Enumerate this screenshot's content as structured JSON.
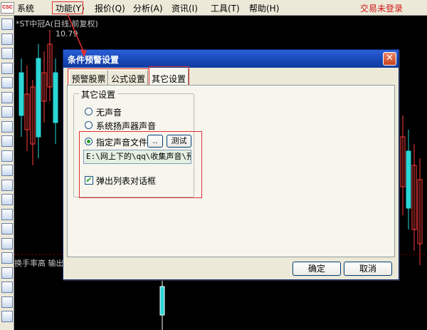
{
  "app": {
    "logo_text": "CSC",
    "login_status": "交易未登录"
  },
  "menu": {
    "items": [
      "系统",
      "功能(Y)",
      "报价(Q)",
      "分析(A)",
      "资讯(I)",
      "工具(T)",
      "帮助(H)"
    ]
  },
  "chart": {
    "title": "*ST中冠A(日线,前复权)",
    "price_label": "10.79",
    "indicator_label": "换手率高 输出",
    "colors": {
      "up": "#ff3b3b",
      "down": "#2ad6d6",
      "background": "#000000"
    }
  },
  "dialog": {
    "title": "条件预警设置",
    "close_label": "✕",
    "tabs": [
      "预警股票",
      "公式设置",
      "其它设置"
    ],
    "active_tab": "其它设置",
    "group_label": "其它设置",
    "options": {
      "no_sound": "无声音",
      "system_speaker": "系统扬声器声音",
      "custom_sound": "指定声音文件",
      "selected": "custom_sound"
    },
    "browse_label": "..",
    "test_label": "测试",
    "sound_path": "E:\\网上下的\\qq\\收集声音\\预",
    "popup_checkbox_label": "弹出列表对话框",
    "popup_checked": true,
    "ok_label": "确定",
    "cancel_label": "取消"
  },
  "toolbar_icons": [
    "window-icon",
    "monitor-icon",
    "line-chart-icon",
    "candle-icon",
    "bars-icon",
    "list-icon",
    "grid-icon",
    "table-icon",
    "mail-icon",
    "people-icon",
    "fund-icon",
    "search-icon",
    "etf-icon",
    "bars2-icon",
    "rsi-icon",
    "chart2-icon",
    "sheet-icon",
    "dollar-icon",
    "tools-icon",
    "exit-icon",
    "pencil-icon"
  ]
}
